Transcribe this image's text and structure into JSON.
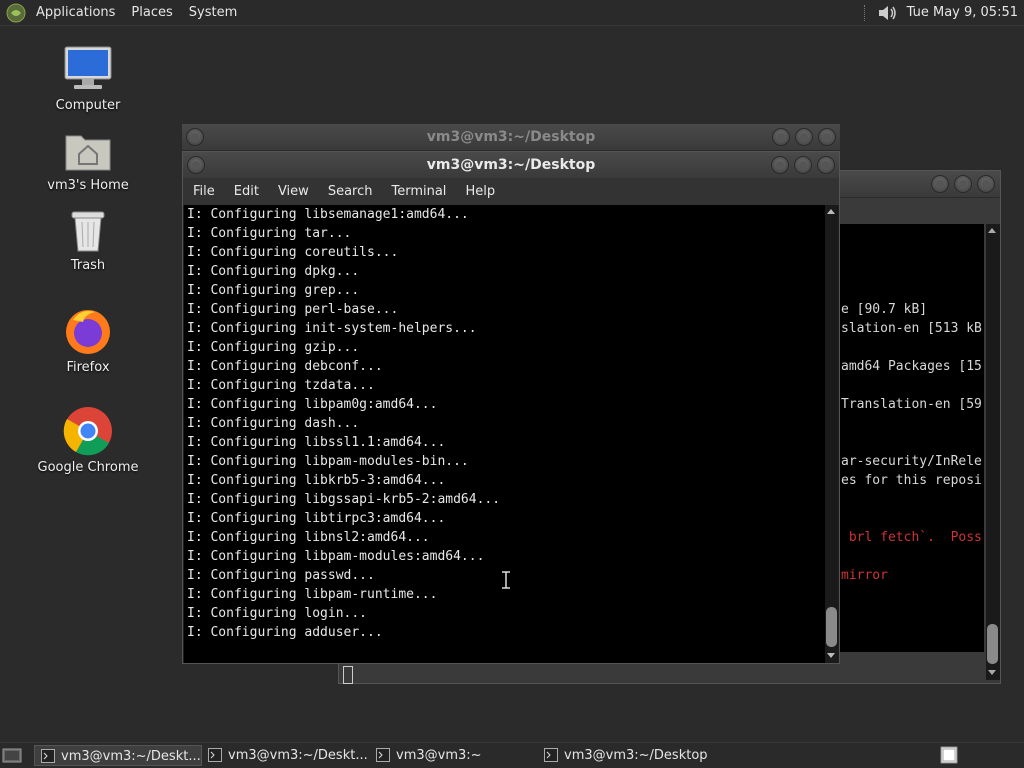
{
  "top_panel": {
    "applications": "Applications",
    "places": "Places",
    "system": "System",
    "clock": "Tue May  9, 05:51"
  },
  "desktop": {
    "icons": [
      {
        "label": "Computer",
        "icon": "computer-icon"
      },
      {
        "label": "vm3's Home",
        "icon": "home-folder-icon"
      },
      {
        "label": "Trash",
        "icon": "trash-icon"
      },
      {
        "label": "Firefox",
        "icon": "firefox-icon"
      },
      {
        "label": "Google Chrome",
        "icon": "chrome-icon"
      }
    ]
  },
  "windows": {
    "back_title": "vm3@vm3:~/Desktop",
    "front_title": "vm3@vm3:~/Desktop",
    "menu": [
      "File",
      "Edit",
      "View",
      "Search",
      "Terminal",
      "Help"
    ],
    "back_terminal_lines": [
      {
        "text": "e [90.7 kB]",
        "red": false
      },
      {
        "text": "slation-en [513 kB",
        "red": false
      },
      {
        "text": "amd64 Packages [15",
        "red": false
      },
      {
        "text": "Translation-en [59",
        "red": false
      },
      {
        "text": "ar-security/InRele",
        "red": false
      },
      {
        "text": "es for this reposi",
        "red": false
      },
      {
        "text": " brl fetch`.  Poss",
        "red": true
      },
      {
        "text": "mirror",
        "red": true
      }
    ],
    "terminal_lines": [
      "I: Configuring libsemanage1:amd64...",
      "I: Configuring tar...",
      "I: Configuring coreutils...",
      "I: Configuring dpkg...",
      "I: Configuring grep...",
      "I: Configuring perl-base...",
      "I: Configuring init-system-helpers...",
      "I: Configuring gzip...",
      "I: Configuring debconf...",
      "I: Configuring tzdata...",
      "I: Configuring libpam0g:amd64...",
      "I: Configuring dash...",
      "I: Configuring libssl1.1:amd64...",
      "I: Configuring libpam-modules-bin...",
      "I: Configuring libkrb5-3:amd64...",
      "I: Configuring libgssapi-krb5-2:amd64...",
      "I: Configuring libtirpc3:amd64...",
      "I: Configuring libnsl2:amd64...",
      "I: Configuring libpam-modules:amd64...",
      "I: Configuring passwd...",
      "I: Configuring libpam-runtime...",
      "I: Configuring login...",
      "I: Configuring adduser..."
    ]
  },
  "taskbar": {
    "tasks": [
      {
        "label": "vm3@vm3:~/Deskt...",
        "active": true
      },
      {
        "label": "vm3@vm3:~/Deskt...",
        "active": false
      },
      {
        "label": "vm3@vm3:~",
        "active": false
      },
      {
        "label": "vm3@vm3:~/Desktop",
        "active": false
      }
    ]
  },
  "colors": {
    "panel_bg": "#2a2a2a",
    "desktop_bg": "#2b2b2b",
    "terminal_bg": "#000000",
    "error_text": "#cc3333"
  }
}
